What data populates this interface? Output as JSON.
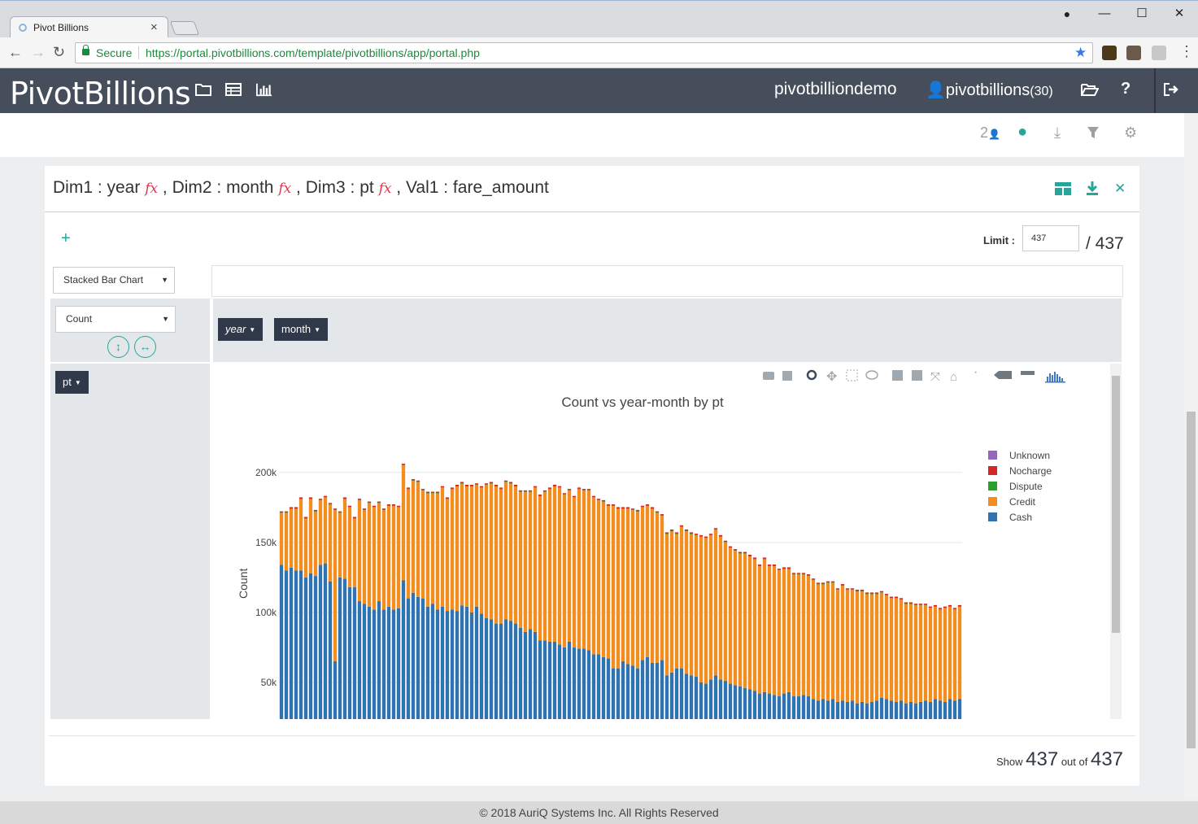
{
  "browser": {
    "tab_title": "Pivot Billions",
    "secure_label": "Secure",
    "url": "https://portal.pivotbillions.com/template/pivotbillions/app/portal.php"
  },
  "header": {
    "brand": "PivotBillions",
    "demo_label": "pivotbilliondemo",
    "user_label": "pivotbillions",
    "user_count": "(30)"
  },
  "toolbar": {
    "users_count": "2"
  },
  "panel": {
    "title_parts": [
      "Dim1 : year ",
      " , Dim2 : month ",
      " , Dim3 : pt ",
      " , Val1 : fare_amount"
    ],
    "fx_label": "fx",
    "add_label": "+",
    "limit_label": "Limit :",
    "limit_value": "437",
    "limit_total": "/ 437",
    "chart_type": "Stacked Bar Chart",
    "measure": "Count",
    "col_dims": [
      "year",
      "month"
    ],
    "row_dims": [
      "pt"
    ],
    "show_prefix": "Show",
    "show_count": "437",
    "show_mid": "out of",
    "show_total": "437"
  },
  "footer": {
    "copyright": "© 2018 AuriQ Systems Inc. All Rights Reserved"
  },
  "colors": {
    "header_bg": "#464d5b",
    "accent": "#26a69a",
    "cash": "#2f74b1",
    "credit": "#f28d1e",
    "dispute": "#2ca02c",
    "nocharge": "#d62728",
    "unknown": "#9467bd"
  },
  "chart_data": {
    "type": "bar",
    "stacked": true,
    "title": "Count vs year-month by pt",
    "xlabel": "",
    "ylabel": "Count",
    "ylim": [
      22000,
      215000
    ],
    "yticks": [
      50000,
      100000,
      150000,
      200000
    ],
    "ytick_labels": [
      "50k",
      "100k",
      "150k",
      "200k"
    ],
    "legend_position": "right",
    "legend": [
      "Unknown",
      "Nocharge",
      "Dispute",
      "Credit",
      "Cash"
    ],
    "series": [
      {
        "name": "Cash",
        "values": [
          134000,
          130000,
          132000,
          130000,
          130000,
          125000,
          128000,
          126000,
          134000,
          135000,
          122000,
          65000,
          125000,
          124000,
          118000,
          118000,
          108000,
          106000,
          104000,
          102000,
          108000,
          102000,
          104000,
          102000,
          103000,
          123000,
          110000,
          114000,
          111000,
          110000,
          104000,
          106000,
          102000,
          104000,
          101000,
          102000,
          101000,
          105000,
          104000,
          100000,
          104000,
          99000,
          96000,
          95000,
          92000,
          92000,
          95000,
          94000,
          92000,
          89000,
          86000,
          88000,
          86000,
          80000,
          80000,
          79000,
          79000,
          77000,
          75000,
          79000,
          75000,
          74000,
          74000,
          73000,
          70000,
          70000,
          68000,
          67000,
          60000,
          60000,
          65000,
          63000,
          62000,
          60000,
          66000,
          68000,
          64000,
          64000,
          66000,
          55000,
          57000,
          60000,
          60000,
          56000,
          55000,
          54000,
          50000,
          49000,
          52000,
          55000,
          52000,
          51000,
          49000,
          48000,
          47000,
          46000,
          45000,
          44000,
          42000,
          43000,
          42000,
          41000,
          40000,
          42000,
          43000,
          40000,
          40000,
          41000,
          40000,
          38000,
          37000,
          38000,
          37000,
          38000,
          36000,
          37000,
          36000,
          37000,
          35000,
          36000,
          35000,
          36000,
          37000,
          39000,
          38000,
          37000,
          36000,
          37000,
          35000,
          36000,
          35000,
          36000,
          37000,
          36000,
          38000,
          37000,
          36000,
          38000,
          37000,
          38000
        ]
      },
      {
        "name": "Credit",
        "values": [
          37000,
          41000,
          42000,
          44000,
          51000,
          42000,
          53000,
          46000,
          46000,
          47000,
          55000,
          108000,
          46000,
          57000,
          57000,
          49000,
          72000,
          67000,
          74000,
          73000,
          70000,
          71000,
          72000,
          74000,
          72000,
          82000,
          78000,
          80000,
          82000,
          77000,
          81000,
          79000,
          83000,
          85000,
          80000,
          86000,
          89000,
          87000,
          86000,
          90000,
          87000,
          90000,
          95000,
          97000,
          98000,
          96000,
          98000,
          98000,
          98000,
          97000,
          100000,
          98000,
          103000,
          103000,
          106000,
          109000,
          111000,
          112000,
          109000,
          108000,
          107000,
          114000,
          113000,
          114000,
          112000,
          110000,
          111000,
          109000,
          116000,
          114000,
          109000,
          111000,
          111000,
          112000,
          109000,
          108000,
          110000,
          107000,
          103000,
          101000,
          101000,
          96000,
          101000,
          102000,
          101000,
          101000,
          104000,
          104000,
          103000,
          104000,
          102000,
          99000,
          97000,
          96000,
          95000,
          96000,
          95000,
          94000,
          91000,
          95000,
          91000,
          92000,
          90000,
          89000,
          88000,
          87000,
          87000,
          86000,
          86000,
          85000,
          83000,
          82000,
          84000,
          83000,
          80000,
          82000,
          80000,
          79000,
          80000,
          79000,
          78000,
          77000,
          76000,
          75000,
          74000,
          73000,
          74000,
          72000,
          71000,
          70000,
          70000,
          69000,
          68000,
          67000,
          66000,
          65000,
          67000,
          66000,
          65000,
          66000
        ]
      },
      {
        "name": "Dispute",
        "values": [
          300,
          300,
          300,
          300,
          300,
          300,
          300,
          300,
          300,
          300,
          300,
          300,
          300,
          300,
          300,
          300,
          300,
          300,
          300,
          300,
          300,
          300,
          300,
          300,
          300,
          300,
          300,
          300,
          300,
          300,
          300,
          300,
          300,
          300,
          300,
          300,
          300,
          300,
          300,
          300,
          300,
          300,
          300,
          300,
          300,
          300,
          300,
          300,
          300,
          300,
          300,
          300,
          300,
          300,
          300,
          300,
          300,
          300,
          300,
          300,
          300,
          300,
          300,
          300,
          300,
          300,
          300,
          300,
          300,
          300,
          300,
          300,
          300,
          300,
          300,
          300,
          300,
          300,
          300,
          300,
          300,
          300,
          300,
          300,
          300,
          300,
          300,
          300,
          300,
          300,
          300,
          300,
          300,
          300,
          300,
          300,
          300,
          300,
          300,
          300,
          300,
          300,
          300,
          300,
          300,
          300,
          300,
          300,
          300,
          300,
          300,
          300,
          300,
          300,
          300,
          300,
          300,
          300,
          300,
          300,
          300,
          300,
          300,
          300,
          300,
          300,
          300,
          300,
          300,
          300,
          300,
          300,
          300,
          300,
          300,
          300,
          300,
          300,
          300,
          300
        ]
      },
      {
        "name": "Nocharge",
        "values": [
          900,
          900,
          900,
          900,
          900,
          900,
          900,
          900,
          900,
          900,
          900,
          900,
          900,
          900,
          900,
          900,
          900,
          900,
          900,
          900,
          900,
          900,
          900,
          900,
          900,
          900,
          900,
          900,
          900,
          900,
          900,
          900,
          900,
          900,
          900,
          900,
          900,
          900,
          900,
          900,
          900,
          900,
          900,
          900,
          900,
          900,
          900,
          900,
          900,
          900,
          900,
          900,
          900,
          900,
          900,
          900,
          900,
          900,
          900,
          900,
          900,
          900,
          900,
          900,
          900,
          900,
          900,
          900,
          900,
          900,
          900,
          900,
          900,
          900,
          900,
          900,
          900,
          900,
          900,
          900,
          900,
          900,
          900,
          900,
          900,
          900,
          900,
          900,
          900,
          900,
          900,
          900,
          900,
          900,
          900,
          900,
          900,
          900,
          900,
          900,
          900,
          900,
          900,
          900,
          900,
          900,
          900,
          900,
          900,
          900,
          900,
          900,
          900,
          900,
          900,
          900,
          900,
          900,
          900,
          900,
          900,
          900,
          900,
          900,
          900,
          900,
          900,
          900,
          900,
          900,
          900,
          900,
          900,
          900,
          900,
          900,
          900,
          900,
          900,
          900
        ]
      },
      {
        "name": "Unknown",
        "values": [
          0,
          0,
          0,
          0,
          0,
          0,
          0,
          0,
          0,
          0,
          0,
          0,
          0,
          0,
          0,
          0,
          0,
          0,
          0,
          0,
          0,
          0,
          0,
          0,
          0,
          0,
          0,
          0,
          0,
          0,
          0,
          0,
          0,
          0,
          0,
          0,
          0,
          0,
          0,
          0,
          0,
          0,
          0,
          0,
          0,
          0,
          0,
          0,
          0,
          0,
          0,
          0,
          0,
          0,
          0,
          0,
          0,
          0,
          0,
          0,
          0,
          0,
          0,
          0,
          0,
          0,
          0,
          0,
          0,
          0,
          0,
          0,
          0,
          0,
          0,
          0,
          0,
          0,
          0,
          0,
          0,
          0,
          0,
          0,
          0,
          0,
          0,
          0,
          0,
          0,
          0,
          0,
          0,
          0,
          0,
          0,
          0,
          0,
          0,
          0,
          0,
          0,
          0,
          0,
          0,
          0,
          0,
          0,
          0,
          0,
          0,
          0,
          0,
          0,
          0,
          0,
          0,
          0,
          0,
          0,
          0,
          0,
          0,
          0,
          0,
          0,
          0,
          0,
          0,
          0,
          0,
          0,
          0,
          0,
          0,
          0,
          0,
          0,
          0,
          0
        ]
      }
    ]
  }
}
